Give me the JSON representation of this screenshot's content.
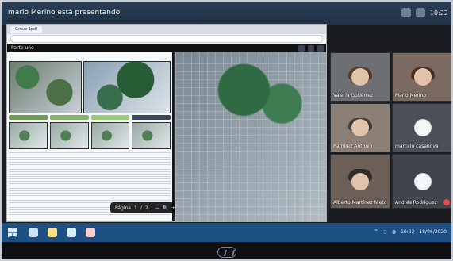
{
  "meeting": {
    "presenter_label": "mario Merino está presentando"
  },
  "top_right": {
    "clock_text": "10:22"
  },
  "presentation": {
    "browser_tab_label": "Group 1pdf",
    "doc_toolbar_center": "Parte uno",
    "page_label": "Página",
    "page_number": "1",
    "page_total": "2"
  },
  "participants": [
    {
      "name": "Valeria Gutiérrez",
      "kind": "video"
    },
    {
      "name": "Mario Merino",
      "kind": "video"
    },
    {
      "name": "Ramírez Antonio",
      "kind": "video"
    },
    {
      "name": "marcelo casanova",
      "kind": "avatar"
    },
    {
      "name": "Alberto Martínez Nieto",
      "kind": "video"
    },
    {
      "name": "Andrés Rodríguez",
      "kind": "avatar"
    }
  ],
  "taskbar": {
    "time": "10:22",
    "date": "18/06/2020"
  },
  "colors": {
    "presenter_bar": "#2a3d52",
    "taskbar": "#1c4f82",
    "alert_red": "#e34b4b"
  }
}
